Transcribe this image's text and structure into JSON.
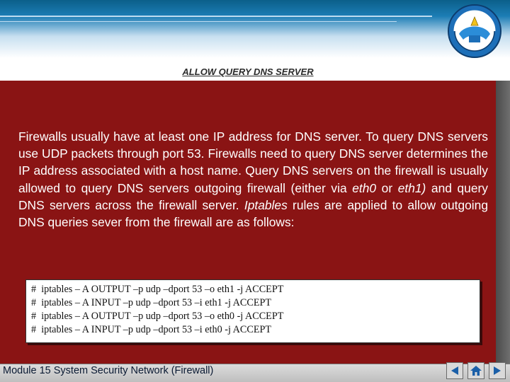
{
  "slide": {
    "title": "ALLOW QUERY DNS SERVER",
    "paragraph": {
      "part1": "Firewalls usually have at least one IP address for DNS server. To query DNS servers use UDP packets through port 53. Firewalls need to query DNS server determines the IP address associated with a host name. Query DNS servers on the firewall is usually allowed to query DNS servers outgoing firewall (either via ",
      "eth0": "eth0",
      "or": " or ",
      "eth1": "eth1)",
      "part2": " and query DNS servers across the firewall server. ",
      "iptables": "Iptables",
      "part3": " rules are applied to allow outgoing DNS queries sever from the firewall are as follows:"
    },
    "code_lines": [
      "#  iptables – A OUTPUT –p udp –dport 53 –o eth1 -j ACCEPT",
      "#  iptables – A INPUT –p udp –dport 53 –i eth1 -j ACCEPT",
      "#  iptables – A OUTPUT –p udp –dport 53 –o eth0 -j ACCEPT",
      "#  iptables – A INPUT –p udp –dport 53 –i eth0 -j ACCEPT"
    ],
    "footer": "Module 15 System Security Network (Firewall)"
  },
  "colors": {
    "panel": "#8a1414",
    "band_top": "#0b5f8a",
    "nav_icon": "#1a5fa8"
  },
  "icons": [
    "logo-emblem",
    "previous-arrow-icon",
    "home-icon",
    "next-arrow-icon"
  ]
}
